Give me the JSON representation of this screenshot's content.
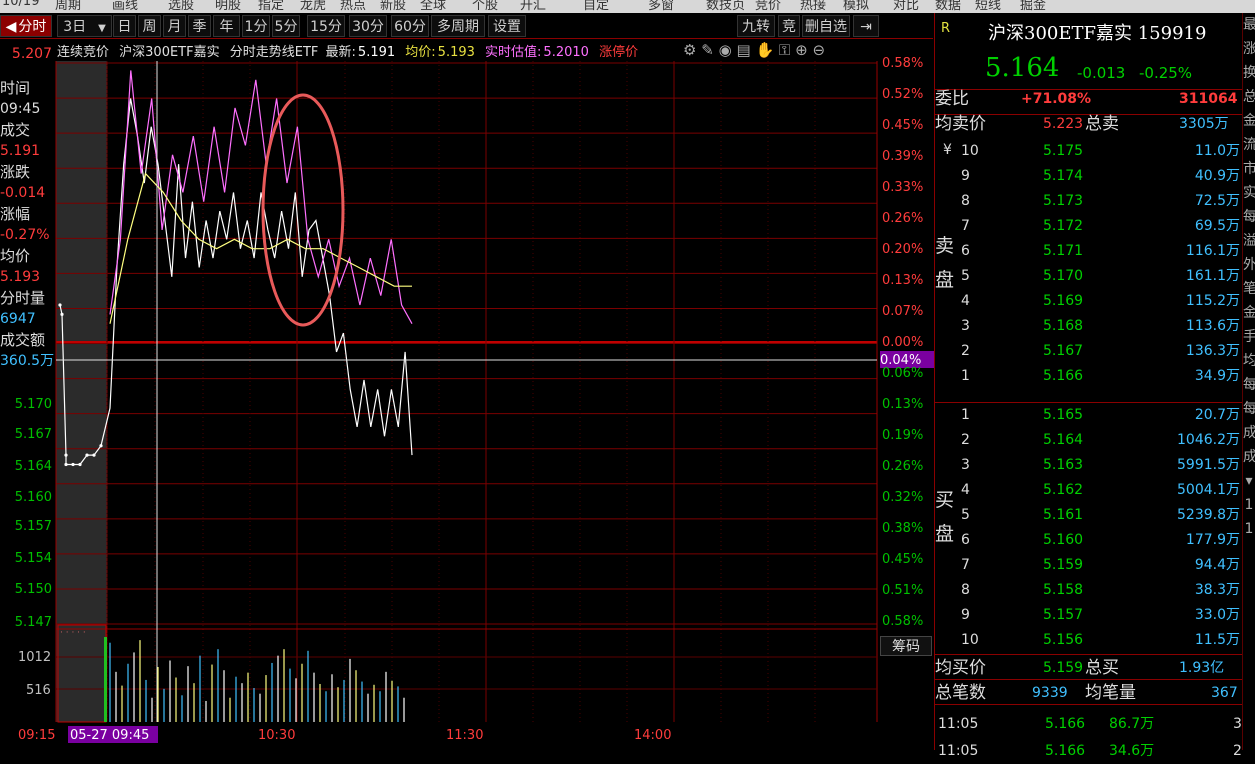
{
  "menubar": {
    "items": [
      "周期",
      "画线",
      "选股",
      "明股",
      "指定",
      "龙虎",
      "热点",
      "新股",
      "全球",
      "个股",
      "开汇",
      "自定",
      "多窗",
      "数技页",
      "竞价",
      "热接",
      "模拟",
      "对比",
      "数据",
      "短线",
      "掘金"
    ],
    "left_text": "10/19"
  },
  "toolbar": {
    "tabs": [
      "分时",
      "3日",
      "日",
      "周",
      "月",
      "季",
      "年",
      "1分",
      "5分",
      "15分",
      "30分",
      "60分",
      "多周期",
      "设置"
    ],
    "right": [
      "九转",
      "竞",
      "删自选"
    ]
  },
  "chart_header": {
    "auction": "连续竞价",
    "name": "沪深300ETF嘉实",
    "mode": "分时走势线ETF",
    "latest_label": "最新:",
    "latest": "5.191",
    "avg_label": "均价:",
    "avg": "5.193",
    "est_label": "实时估值:",
    "est": "5.2010",
    "limit_label": "涨停价"
  },
  "left_info": {
    "time_label": "时间",
    "time": "09:45",
    "vol_label": "成交",
    "vol": "5.191",
    "chg_label": "涨跌",
    "chg": "-0.014",
    "pct_label": "涨幅",
    "pct": "-0.27%",
    "avg_label": "均价",
    "avg": "5.193",
    "minvol_label": "分时量",
    "minvol": "6947",
    "amt_label": "成交额",
    "amt": "360.5万",
    "top_price": "5.207"
  },
  "y_axis_left": [
    "5.170",
    "5.167",
    "5.164",
    "5.160",
    "5.157",
    "5.154",
    "5.150",
    "5.147"
  ],
  "y_axis_right_up": [
    "0.58%",
    "0.52%",
    "0.45%",
    "0.39%",
    "0.33%",
    "0.26%",
    "0.20%",
    "0.13%",
    "0.07%",
    "0.00%"
  ],
  "y_axis_right_down": [
    "0.06%",
    "0.13%",
    "0.19%",
    "0.26%",
    "0.32%",
    "0.38%",
    "0.45%",
    "0.51%",
    "0.58%"
  ],
  "cursor_pct": "0.04%",
  "vol_axis": [
    "1012",
    "516"
  ],
  "chip_label": "筹码",
  "x_axis": {
    "start": "09:15",
    "cursor": "05-27 09:45",
    "t1": "10:30",
    "t2": "11:30",
    "t3": "14:00"
  },
  "quote": {
    "flag": "R",
    "title": "沪深300ETF嘉实 159919",
    "price": "5.164",
    "change": "-0.013",
    "pct": "-0.25%",
    "weibi_label": "委比",
    "weibi": "+71.08%",
    "weicha": "311064",
    "avg_sell_label": "均卖价",
    "avg_sell": "5.223",
    "total_sell_label": "总卖",
    "total_sell": "3305万",
    "sell_label": "卖盘",
    "buy_label": "买盘",
    "yen": "¥",
    "asks": [
      [
        "10",
        "5.175",
        "11.0万"
      ],
      [
        "9",
        "5.174",
        "40.9万"
      ],
      [
        "8",
        "5.173",
        "72.5万"
      ],
      [
        "7",
        "5.172",
        "69.5万"
      ],
      [
        "6",
        "5.171",
        "116.1万"
      ],
      [
        "5",
        "5.170",
        "161.1万"
      ],
      [
        "4",
        "5.169",
        "115.2万"
      ],
      [
        "3",
        "5.168",
        "113.6万"
      ],
      [
        "2",
        "5.167",
        "136.3万"
      ],
      [
        "1",
        "5.166",
        "34.9万"
      ]
    ],
    "bids": [
      [
        "1",
        "5.165",
        "20.7万"
      ],
      [
        "2",
        "5.164",
        "1046.2万"
      ],
      [
        "3",
        "5.163",
        "5991.5万"
      ],
      [
        "4",
        "5.162",
        "5004.1万"
      ],
      [
        "5",
        "5.161",
        "5239.8万"
      ],
      [
        "6",
        "5.160",
        "177.9万"
      ],
      [
        "7",
        "5.159",
        "94.4万"
      ],
      [
        "8",
        "5.158",
        "38.3万"
      ],
      [
        "9",
        "5.157",
        "33.0万"
      ],
      [
        "10",
        "5.156",
        "11.5万"
      ]
    ],
    "avg_buy_label": "均买价",
    "avg_buy": "5.159",
    "total_buy_label": "总买",
    "total_buy": "1.93亿",
    "total_trades_label": "总笔数",
    "total_trades": "9339",
    "avg_trade_label": "均笔量",
    "avg_trade": "367",
    "ticks": [
      [
        "11:05",
        "5.166",
        "86.7万",
        "3"
      ],
      [
        "11:05",
        "5.166",
        "34.6万",
        "2"
      ]
    ]
  },
  "far_right": [
    "最",
    "涨",
    "换",
    "总",
    "金",
    "流",
    "市",
    "实",
    "每",
    "溢",
    "外",
    "",
    "笔",
    "金",
    "手",
    "均",
    "每",
    "每",
    "成",
    "成",
    "▾",
    "1",
    "1"
  ],
  "chart_data": {
    "type": "line",
    "x_range": [
      "09:15",
      "15:00"
    ],
    "y_range": [
      5.147,
      5.207
    ],
    "series": [
      {
        "color": "#ffffff",
        "values": [
          5.181,
          5.18,
          5.165,
          5.164,
          5.164,
          5.164,
          5.165,
          5.165,
          5.166,
          5.17,
          5.185,
          5.196,
          5.203,
          5.199,
          5.194,
          5.2,
          5.196,
          5.19,
          5.184,
          5.196,
          5.186,
          5.192,
          5.185,
          5.19,
          5.186,
          5.191,
          5.188,
          5.193,
          5.187,
          5.19,
          5.186,
          5.193,
          5.189,
          5.186,
          5.191,
          5.187,
          5.193,
          5.184,
          5.189,
          5.19,
          5.186,
          5.182,
          5.176,
          5.178,
          5.172,
          5.168,
          5.173,
          5.168,
          5.172,
          5.167,
          5.172,
          5.168,
          5.176,
          5.165
        ]
      },
      {
        "color": "#ff70ff",
        "values": [
          5.18,
          5.188,
          5.206,
          5.195,
          5.203,
          5.189,
          5.197,
          5.193,
          5.199,
          5.192,
          5.2,
          5.193,
          5.202,
          5.198,
          5.205,
          5.196,
          5.203,
          5.194,
          5.2,
          5.188,
          5.184,
          5.188,
          5.183,
          5.186,
          5.181,
          5.186,
          5.182,
          5.188,
          5.181,
          5.179
        ]
      },
      {
        "color": "#ffff80",
        "values": [
          5.179,
          5.188,
          5.195,
          5.193,
          5.19,
          5.188,
          5.187,
          5.188,
          5.187,
          5.187,
          5.188,
          5.187,
          5.187,
          5.186,
          5.185,
          5.184,
          5.183,
          5.183
        ]
      }
    ],
    "volume": [
      980,
      620,
      450,
      720,
      860,
      1012,
      520,
      300,
      680,
      410,
      760,
      550,
      330,
      690,
      480,
      820,
      260,
      710,
      900,
      640,
      300,
      560,
      480,
      610,
      420,
      350,
      580,
      730,
      820,
      900,
      660,
      540,
      720,
      880,
      610,
      470,
      380,
      590,
      430,
      520,
      780,
      640,
      500,
      350,
      460,
      380,
      620,
      510,
      440,
      300
    ]
  }
}
